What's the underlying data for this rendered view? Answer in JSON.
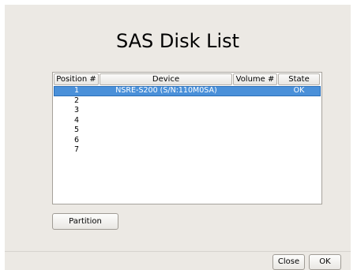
{
  "dialog": {
    "title": "SAS Disk List"
  },
  "table": {
    "columns": [
      "Position #",
      "Device",
      "Volume #",
      "State"
    ],
    "rows": [
      {
        "position": "1",
        "device": "NSRE-S200 (S/N:110M0SA)",
        "volume": "",
        "state": "OK",
        "selected": true
      },
      {
        "position": "2",
        "device": "",
        "volume": "",
        "state": "",
        "selected": false
      },
      {
        "position": "3",
        "device": "",
        "volume": "",
        "state": "",
        "selected": false
      },
      {
        "position": "4",
        "device": "",
        "volume": "",
        "state": "",
        "selected": false
      },
      {
        "position": "5",
        "device": "",
        "volume": "",
        "state": "",
        "selected": false
      },
      {
        "position": "6",
        "device": "",
        "volume": "",
        "state": "",
        "selected": false
      },
      {
        "position": "7",
        "device": "",
        "volume": "",
        "state": "",
        "selected": false
      }
    ],
    "selected_color": "#4a90d9"
  },
  "buttons": {
    "partition": "Partition",
    "close": "Close",
    "ok": "OK"
  }
}
